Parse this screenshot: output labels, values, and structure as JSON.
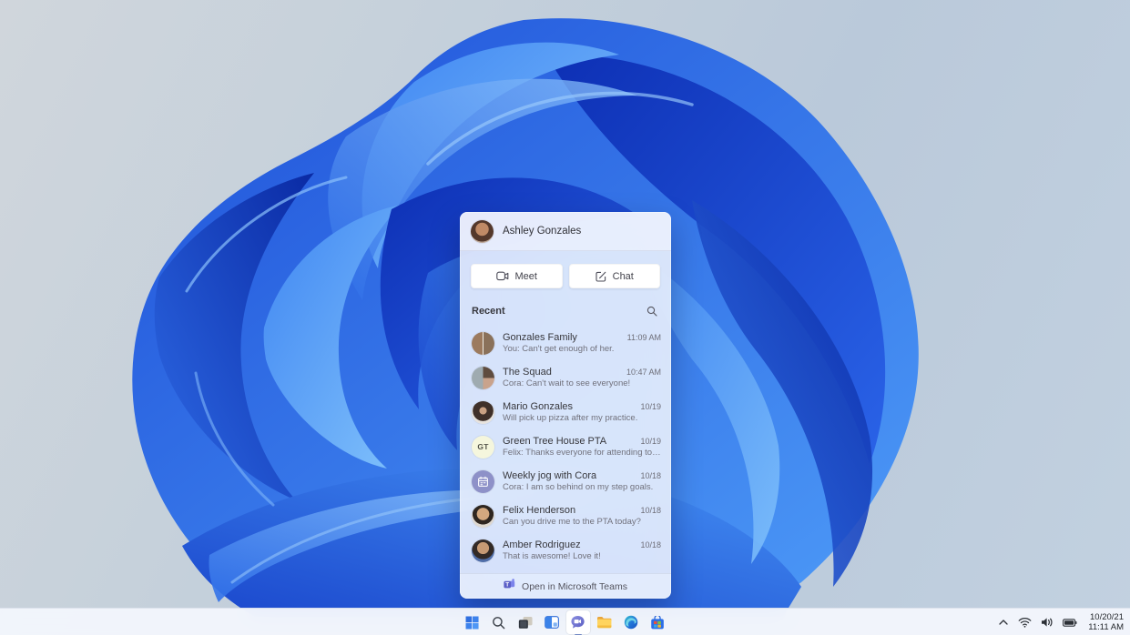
{
  "wallpaper": {
    "bg_top_left": "#d0d6dc",
    "bg_right": "#bac9da",
    "bloom_deep": "#0d2fb4",
    "bloom_mid": "#1e4fd8",
    "bloom_bright": "#4e9cf8",
    "bloom_highlight": "#8ac1fb"
  },
  "chat_flyout": {
    "header": {
      "user_name": "Ashley Gonzales",
      "avatar_bg": "radial-gradient(circle at 50% 40%, #c08a66 0 36%, #54382b 38% 68%, #b9a393 70%)"
    },
    "actions": {
      "meet_label": "Meet",
      "chat_label": "Chat",
      "meet_icon": "video-camera-icon",
      "chat_icon": "compose-icon"
    },
    "recent": {
      "title": "Recent",
      "search_icon": "search-icon"
    },
    "conversations": [
      {
        "name": "Gonzales Family",
        "preview": "You: Can't get enough of her.",
        "time": "11:09 AM",
        "avatar": {
          "kind": "photo",
          "bg": "linear-gradient(90deg,#9c7a5e 0 48%,#f0ede7 48% 52%,#8a715a 52%)"
        }
      },
      {
        "name": "The Squad",
        "preview": "Cora: Can't wait to see everyone!",
        "time": "10:47 AM",
        "avatar": {
          "kind": "photo",
          "bg": "conic-gradient(from 180deg, #9fabb0 0 180deg, #5f4c3f 180deg 270deg, #c9a38c 270deg 360deg)"
        }
      },
      {
        "name": "Mario Gonzales",
        "preview": "Will pick up pizza after my practice.",
        "time": "10/19",
        "avatar": {
          "kind": "photo",
          "bg": "radial-gradient(circle at 50% 42%, #caa183 0 20%, #3f3029 22% 58%, #e7e3de 60%)"
        }
      },
      {
        "name": "Green Tree House PTA",
        "preview": "Felix: Thanks everyone for attending today.",
        "time": "10/19",
        "avatar": {
          "kind": "initials",
          "text": "GT",
          "bg": "#f5f6dd",
          "fg": "#55554a"
        }
      },
      {
        "name": "Weekly jog with Cora",
        "preview": "Cora: I am so behind on my step goals.",
        "time": "10/18",
        "avatar": {
          "kind": "calendar-icon",
          "bg": "#8e91c8",
          "fg": "#ffffff"
        }
      },
      {
        "name": "Felix Henderson",
        "preview": "Can you drive me to the PTA today?",
        "time": "10/18",
        "avatar": {
          "kind": "photo",
          "bg": "radial-gradient(circle at 50% 40%, #d3a87f 0 34%, #2e2620 36% 58%, #ded8d0 60%)"
        }
      },
      {
        "name": "Amber Rodriguez",
        "preview": "That is awesome! Love it!",
        "time": "10/18",
        "avatar": {
          "kind": "photo",
          "bg": "radial-gradient(circle at 50% 38%, #c79a74 0 32%, #332a26 34% 60%, #4f6da8 62%)"
        }
      }
    ],
    "footer": {
      "label": "Open in Microsoft Teams",
      "icon": "teams-logo-icon",
      "teams_purple": "#5b5fc7"
    }
  },
  "taskbar": {
    "items": [
      {
        "name": "start"
      },
      {
        "name": "search"
      },
      {
        "name": "task-view"
      },
      {
        "name": "widgets"
      },
      {
        "name": "chat",
        "active": true
      },
      {
        "name": "file-explorer"
      },
      {
        "name": "edge"
      },
      {
        "name": "store"
      }
    ],
    "active_item": "chat",
    "tray": {
      "icons": [
        "chevron-up-icon",
        "wifi-icon",
        "volume-icon",
        "battery-icon"
      ],
      "date": "10/20/21",
      "time": "11:11 AM"
    }
  }
}
